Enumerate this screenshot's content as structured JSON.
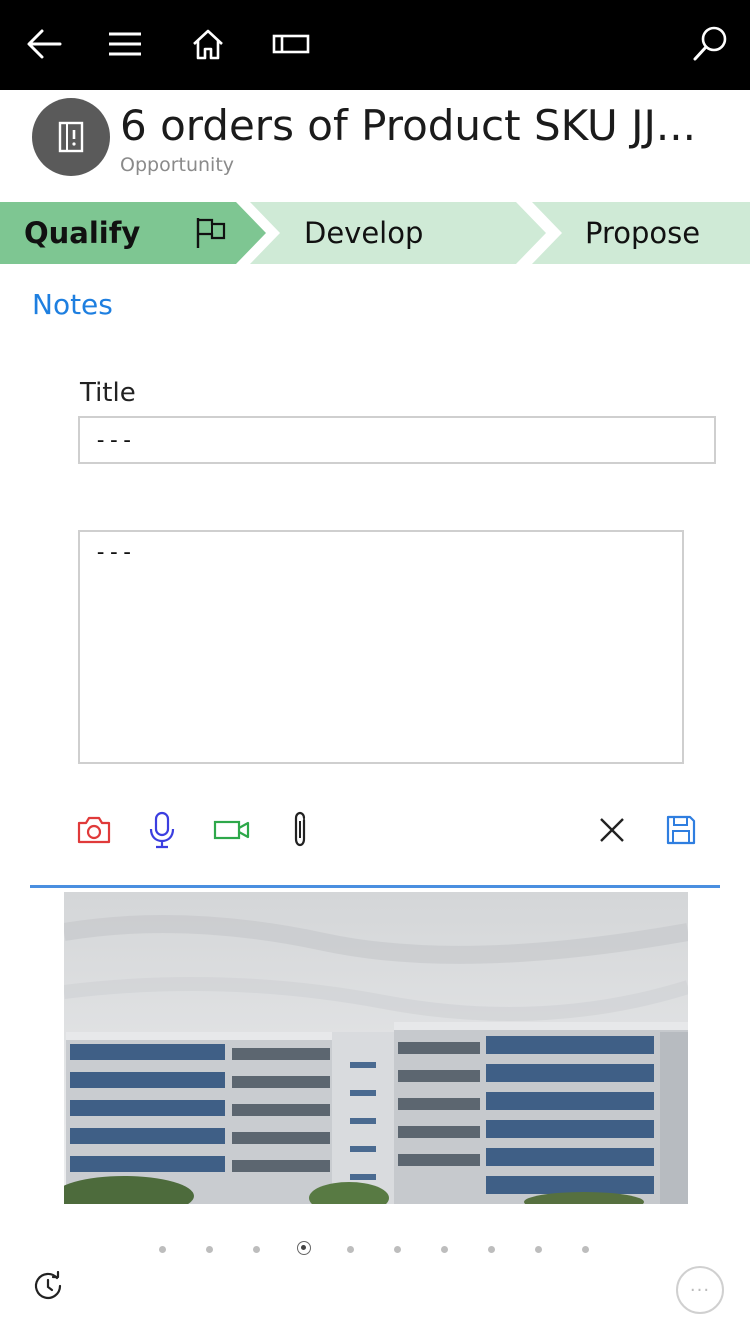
{
  "topbar": {
    "icons": [
      "back-arrow-icon",
      "hamburger-menu-icon",
      "home-icon",
      "window-icon",
      "search-icon"
    ]
  },
  "header": {
    "title": "6 orders of Product SKU JJ...",
    "subtitle": "Opportunity",
    "avatar_icon": "opportunity-icon"
  },
  "stages": [
    {
      "label": "Qualify",
      "active": true,
      "flag_icon": "flag-icon"
    },
    {
      "label": "Develop",
      "active": false
    },
    {
      "label": "Propose",
      "active": false
    }
  ],
  "colors": {
    "stage_active": "#7ec692",
    "stage_inactive": "#cfead6",
    "link_blue": "#1e7fe0",
    "camera_red": "#e03a3a",
    "mic_blue": "#3b3ee0",
    "video_green": "#2ea84a",
    "save_blue": "#2f7ee0"
  },
  "notes": {
    "section_title": "Notes",
    "title_label": "Title",
    "title_value": "---",
    "body_value": "---"
  },
  "toolbar": {
    "icons": [
      "camera-icon",
      "microphone-icon",
      "video-icon",
      "paperclip-icon",
      "close-icon",
      "save-icon"
    ]
  },
  "carousel": {
    "page_count": 10,
    "active_index": 3
  },
  "bottom": {
    "left_icon": "clock-refresh-icon",
    "more_label": "···"
  }
}
